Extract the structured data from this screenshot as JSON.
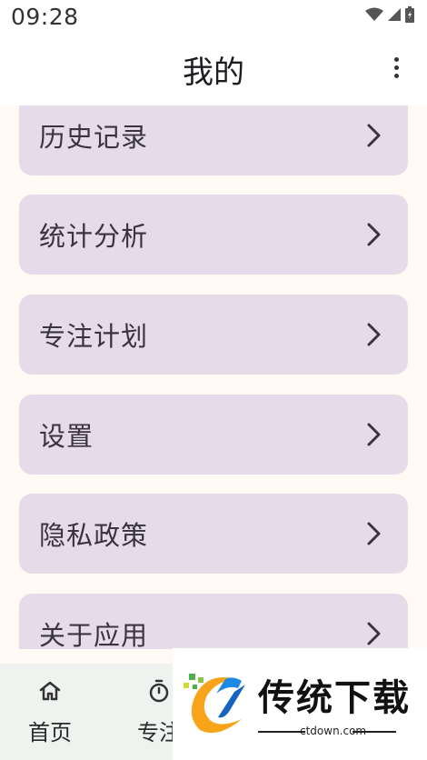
{
  "status_bar": {
    "time": "09:28"
  },
  "app_bar": {
    "title": "我的"
  },
  "menu": [
    {
      "label": "历史记录"
    },
    {
      "label": "统计分析"
    },
    {
      "label": "专注计划"
    },
    {
      "label": "设置"
    },
    {
      "label": "隐私政策"
    },
    {
      "label": "关于应用"
    }
  ],
  "bottom_nav": [
    {
      "label": "首页",
      "icon": "home-icon"
    },
    {
      "label": "专注",
      "icon": "timer-icon"
    }
  ],
  "watermark": {
    "brand": "传统下载",
    "url": "ctdown.com"
  },
  "colors": {
    "card": "#e5dcea",
    "background": "#fffaf3",
    "nav": "#eef3ef"
  }
}
